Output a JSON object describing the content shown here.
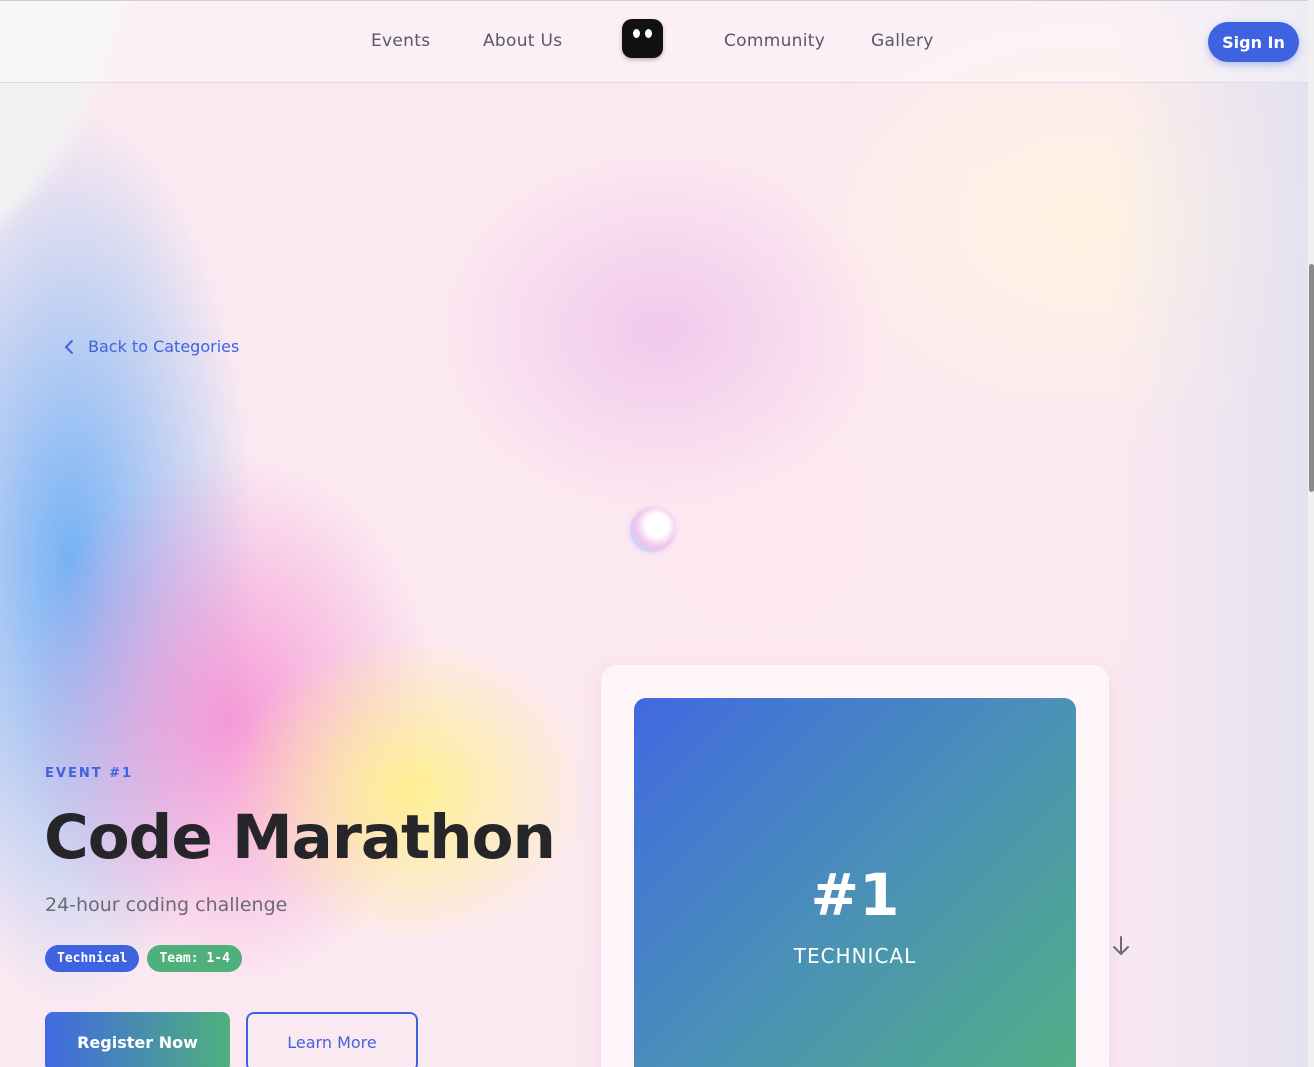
{
  "nav": {
    "links": [
      "Events",
      "About Us",
      "Community",
      "Gallery"
    ],
    "sign_in": "Sign In",
    "logo_icon": "robot-face-icon"
  },
  "back_link": {
    "label": "Back to Categories",
    "icon": "chevron-left-icon"
  },
  "event": {
    "kicker": "EVENT #1",
    "title": "Code Marathon",
    "subtitle": "24-hour coding challenge",
    "tags": [
      "Technical",
      "Team: 1-4"
    ],
    "register_label": "Register Now",
    "learn_more_label": "Learn More"
  },
  "card": {
    "number": "#1",
    "category": "TECHNICAL",
    "gradient": [
      "#4169e1",
      "#52b083"
    ]
  },
  "scroll_icon": "arrow-down-icon",
  "colors": {
    "accent": "#3f63e0",
    "green": "#4fb07c",
    "text_dark": "#25252a"
  }
}
